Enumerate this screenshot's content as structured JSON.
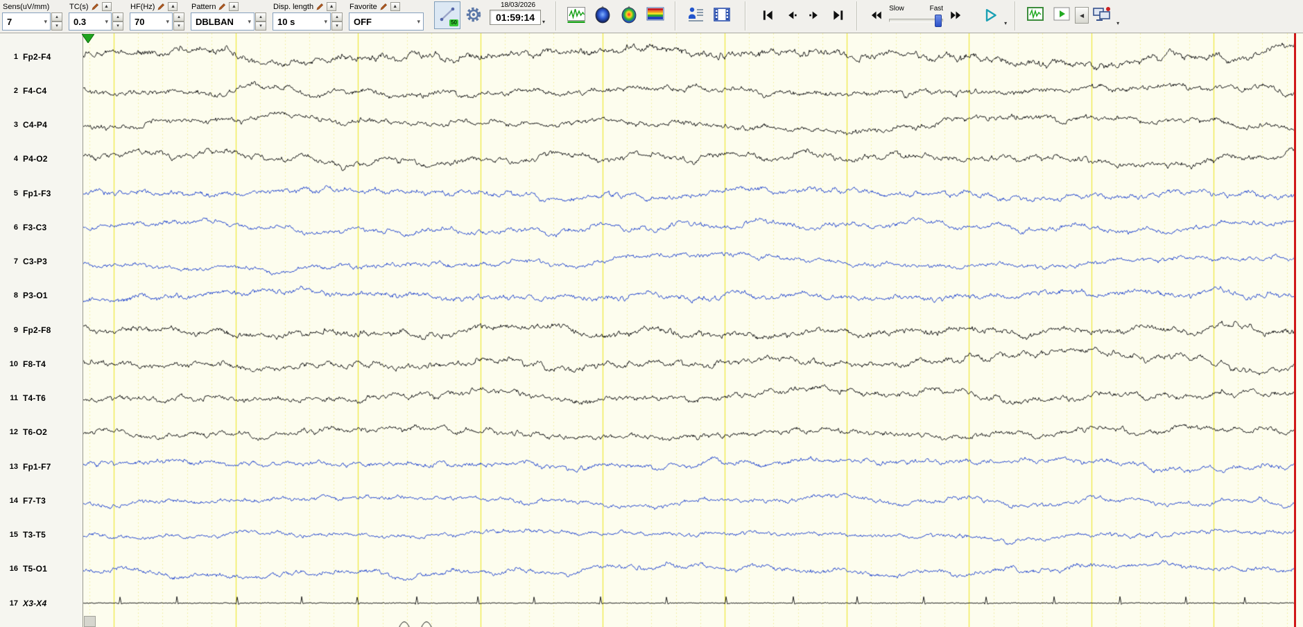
{
  "toolbar": {
    "sens": {
      "label": "Sens(uV/mm)",
      "value": "7"
    },
    "tc": {
      "label": "TC(s)",
      "value": "0.3"
    },
    "hf": {
      "label": "HF(Hz)",
      "value": "70"
    },
    "pattern": {
      "label": "Pattern",
      "value": "DBLBAN"
    },
    "disp_length": {
      "label": "Disp. length",
      "value": "10 s"
    },
    "favorite": {
      "label": "Favorite",
      "value": "OFF"
    },
    "notch_badge": "50",
    "datetime": {
      "date": "18/03/2026",
      "time": "01:59:14"
    },
    "speed": {
      "slow_label": "Slow",
      "fast_label": "Fast"
    }
  },
  "icons": {
    "dropdown_arrow": "▾",
    "spinner_up": "▴",
    "spinner_down": "▾",
    "expand_up": "▲",
    "collapse_left": "◀"
  },
  "channels": [
    {
      "num": "1",
      "label": "Fp2-F4",
      "color": "black"
    },
    {
      "num": "2",
      "label": "F4-C4",
      "color": "black"
    },
    {
      "num": "3",
      "label": "C4-P4",
      "color": "black"
    },
    {
      "num": "4",
      "label": "P4-O2",
      "color": "black"
    },
    {
      "num": "5",
      "label": "Fp1-F3",
      "color": "blue"
    },
    {
      "num": "6",
      "label": "F3-C3",
      "color": "blue"
    },
    {
      "num": "7",
      "label": "C3-P3",
      "color": "blue"
    },
    {
      "num": "8",
      "label": "P3-O1",
      "color": "blue"
    },
    {
      "num": "9",
      "label": "Fp2-F8",
      "color": "black"
    },
    {
      "num": "10",
      "label": "F8-T4",
      "color": "black"
    },
    {
      "num": "11",
      "label": "T4-T6",
      "color": "black"
    },
    {
      "num": "12",
      "label": "T6-O2",
      "color": "black"
    },
    {
      "num": "13",
      "label": "Fp1-F7",
      "color": "blue"
    },
    {
      "num": "14",
      "label": "F7-T3",
      "color": "blue"
    },
    {
      "num": "15",
      "label": "T3-T5",
      "color": "blue"
    },
    {
      "num": "16",
      "label": "T5-O1",
      "color": "blue"
    },
    {
      "num": "17",
      "label": "X3-X4",
      "color": "black",
      "italic": true,
      "kind": "ecg"
    }
  ],
  "display": {
    "background": "#fdfdee",
    "grid_major_color": "#eeea3c",
    "grid_minor_color": "#f2f0a8",
    "trace_black": "#1b1b1b",
    "trace_blue": "#2a4cd0",
    "cursor_color": "#d01818",
    "marker_color": "#1fa41f"
  }
}
